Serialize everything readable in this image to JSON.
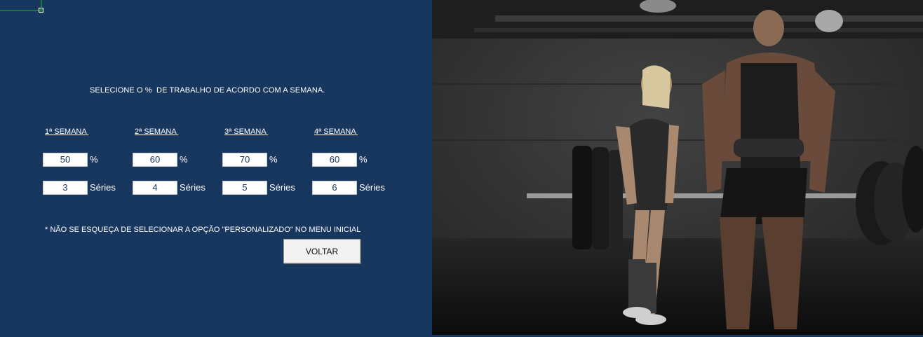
{
  "instruction": "SELECIONE O %  DE TRABALHO DE ACORDO COM A SEMANA.",
  "weeks": [
    {
      "label": "1ª SEMANA ",
      "percent": "50",
      "series": "3"
    },
    {
      "label": "2ª SEMANA ",
      "percent": "60",
      "series": "4"
    },
    {
      "label": "3ª SEMANA ",
      "percent": "70",
      "series": "5"
    },
    {
      "label": "4ª SEMANA ",
      "percent": "60",
      "series": "6"
    }
  ],
  "units": {
    "percent": "%",
    "series": "Séries"
  },
  "note": "* NÃO SE ESQUEÇA DE SELECIONAR A OPÇÃO \"PERSONALIZADO\" NO MENU INICIAL",
  "back_button": "VOLTAR",
  "colors": {
    "panel_bg": "#17375e",
    "cell_cursor": "#217346"
  },
  "photo": {
    "subject": "gym-weightlifting-photo"
  }
}
